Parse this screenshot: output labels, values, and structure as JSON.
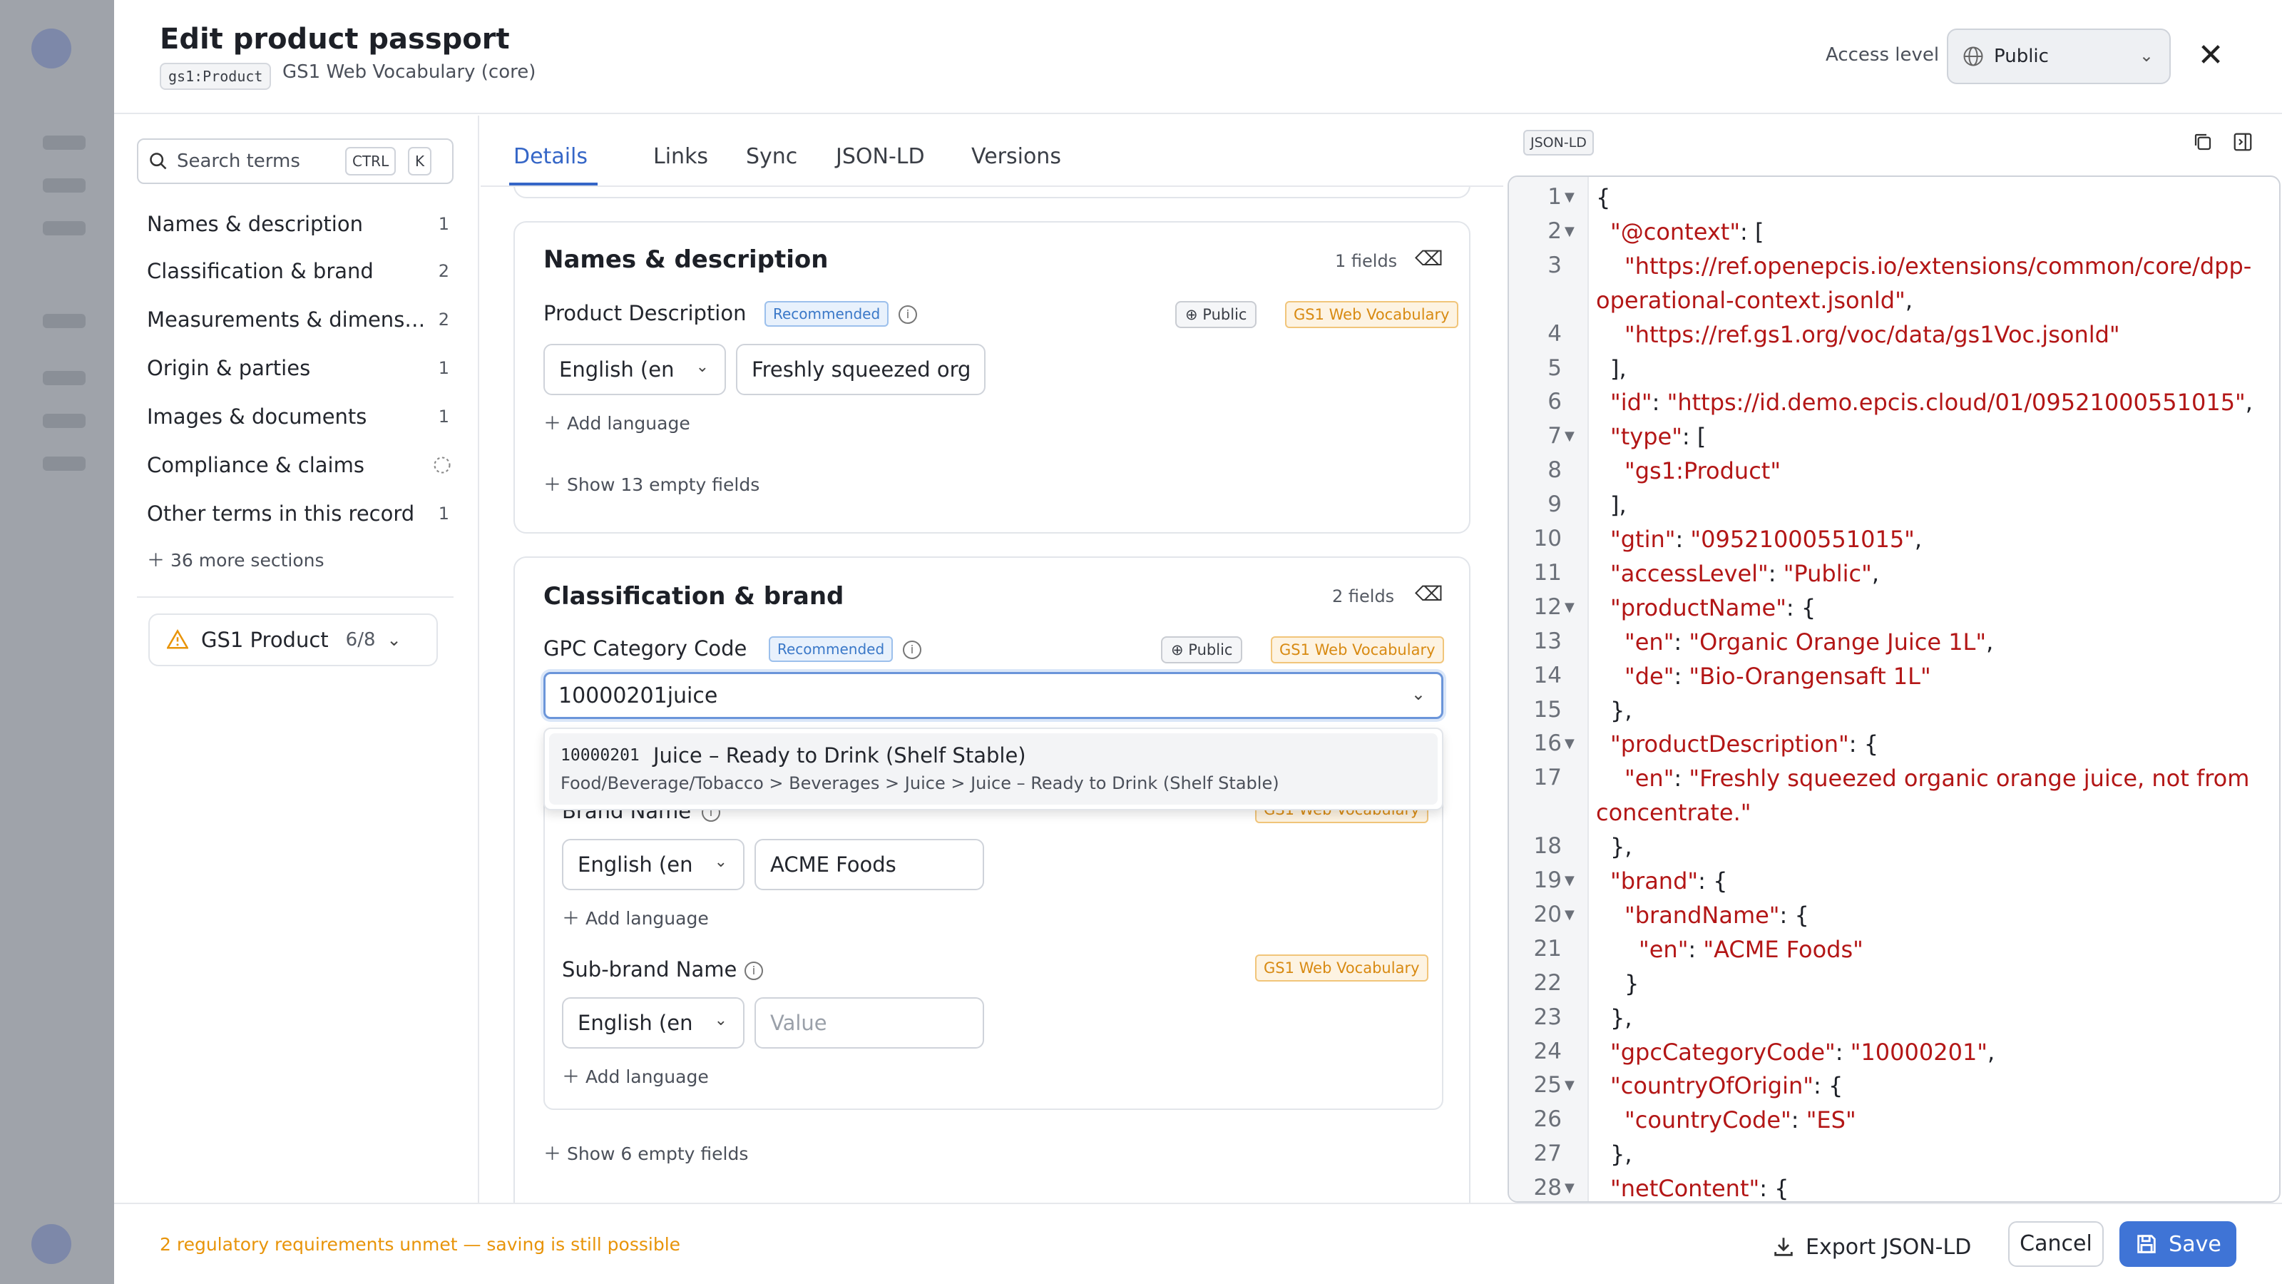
{
  "header": {
    "title": "Edit product passport",
    "type_tag": "gs1:Product",
    "subtitle": "GS1 Web Vocabulary (core)",
    "access_label": "Access level",
    "access_value": "Public"
  },
  "sidebar": {
    "search_placeholder": "Search terms",
    "kbd": [
      "CTRL",
      "K"
    ],
    "items": [
      {
        "label": "Names & description",
        "count": "1"
      },
      {
        "label": "Classification & brand",
        "count": "2"
      },
      {
        "label": "Measurements & dimens…",
        "count": "2"
      },
      {
        "label": "Origin & parties",
        "count": "1"
      },
      {
        "label": "Images & documents",
        "count": "1"
      },
      {
        "label": "Compliance & claims",
        "count": ""
      },
      {
        "label": "Other terms in this record",
        "count": "1"
      }
    ],
    "more_sections": "36 more sections",
    "gs1_label": "GS1 Product",
    "gs1_count": "6/8"
  },
  "tabs": [
    "Details",
    "Links",
    "Sync",
    "JSON-LD",
    "Versions"
  ],
  "names_card": {
    "title": "Names & description",
    "field_count": "1 fields",
    "field_label": "Product Description",
    "recommended": "Recommended",
    "public_badge": "Public",
    "vocab_badge": "GS1 Web Vocabulary",
    "language": "English (en",
    "value": "Freshly squeezed org",
    "add_language": "Add language",
    "show_empty": "Show 13 empty fields"
  },
  "class_card": {
    "title": "Classification & brand",
    "field_count": "2 fields",
    "gpc_label": "GPC Category Code",
    "recommended": "Recommended",
    "public_badge": "Public",
    "vocab_badge": "GS1 Web Vocabulary",
    "combo_value": "10000201juice",
    "option_code": "10000201",
    "option_name": "Juice – Ready to Drink (Shelf Stable)",
    "option_path": "Food/Beverage/Tobacco > Beverages > Juice > Juice – Ready to Drink (Shelf Stable)",
    "brand_label": "Brand Name",
    "brand_vocab": "GS1 Web Vocabulary",
    "brand_language": "English (en",
    "brand_value": "ACME Foods",
    "add_language": "Add language",
    "subbrand_label": "Sub-brand Name",
    "subbrand_vocab": "GS1 Web Vocabulary",
    "subbrand_language": "English (en",
    "subbrand_placeholder": "Value",
    "add_language2": "Add language",
    "show_empty": "Show 6 empty fields"
  },
  "json_panel": {
    "tag": "JSON-LD",
    "lines": [
      {
        "n": "1",
        "fold": true,
        "t": "{"
      },
      {
        "n": "2",
        "fold": true,
        "k": "\"@context\"",
        "t": ": ["
      },
      {
        "n": "3",
        "fold": false,
        "s": "\"https://ref.openepcis.io/extensions/common/core/dpp-"
      },
      {
        "n": "",
        "fold": false,
        "s": "operational-context.jsonld\"",
        "t": ","
      },
      {
        "n": "4",
        "fold": false,
        "s": "\"https://ref.gs1.org/voc/data/gs1Voc.jsonld\""
      },
      {
        "n": "5",
        "fold": false,
        "t": "],"
      },
      {
        "n": "6",
        "fold": false,
        "k": "\"id\"",
        "t": ": ",
        "s": "\"https://id.demo.epcis.cloud/01/09521000551015\"",
        "t2": ","
      },
      {
        "n": "7",
        "fold": true,
        "k": "\"type\"",
        "t": ": ["
      },
      {
        "n": "8",
        "fold": false,
        "s": "\"gs1:Product\""
      },
      {
        "n": "9",
        "fold": false,
        "t": "],"
      },
      {
        "n": "10",
        "fold": false,
        "k": "\"gtin\"",
        "t": ": ",
        "s": "\"09521000551015\"",
        "t2": ","
      },
      {
        "n": "11",
        "fold": false,
        "k": "\"accessLevel\"",
        "t": ": ",
        "s": "\"Public\"",
        "t2": ","
      },
      {
        "n": "12",
        "fold": true,
        "k": "\"productName\"",
        "t": ": {"
      },
      {
        "n": "13",
        "fold": false,
        "k": "\"en\"",
        "t": ": ",
        "s": "\"Organic Orange Juice 1L\"",
        "t2": ","
      },
      {
        "n": "14",
        "fold": false,
        "k": "\"de\"",
        "t": ": ",
        "s": "\"Bio-Orangensaft 1L\""
      },
      {
        "n": "15",
        "fold": false,
        "t": "},"
      },
      {
        "n": "16",
        "fold": true,
        "k": "\"productDescription\"",
        "t": ": {"
      },
      {
        "n": "17",
        "fold": false,
        "k": "\"en\"",
        "t": ": ",
        "s": "\"Freshly squeezed organic orange juice, not from"
      },
      {
        "n": "",
        "fold": false,
        "s": "concentrate.\""
      },
      {
        "n": "18",
        "fold": false,
        "t": "},"
      },
      {
        "n": "19",
        "fold": true,
        "k": "\"brand\"",
        "t": ": {"
      },
      {
        "n": "20",
        "fold": true,
        "k": "\"brandName\"",
        "t": ": {"
      },
      {
        "n": "21",
        "fold": false,
        "k": "\"en\"",
        "t": ": ",
        "s": "\"ACME Foods\""
      },
      {
        "n": "22",
        "fold": false,
        "t": "}"
      },
      {
        "n": "23",
        "fold": false,
        "t": "},"
      },
      {
        "n": "24",
        "fold": false,
        "k": "\"gpcCategoryCode\"",
        "t": ": ",
        "s": "\"10000201\"",
        "t2": ","
      },
      {
        "n": "25",
        "fold": true,
        "k": "\"countryOfOrigin\"",
        "t": ": {"
      },
      {
        "n": "26",
        "fold": false,
        "k": "\"countryCode\"",
        "t": ": ",
        "s": "\"ES\""
      },
      {
        "n": "27",
        "fold": false,
        "t": "},"
      },
      {
        "n": "28",
        "fold": true,
        "k": "\"netContent\"",
        "t": ": {"
      }
    ]
  },
  "footer": {
    "warning": "2 regulatory requirements unmet — saving is still possible",
    "export": "Export JSON-LD",
    "cancel": "Cancel",
    "save": "Save"
  },
  "colors": {
    "accent": "#3f74d6",
    "warning": "#e8940a",
    "json_string": "#b31616"
  }
}
